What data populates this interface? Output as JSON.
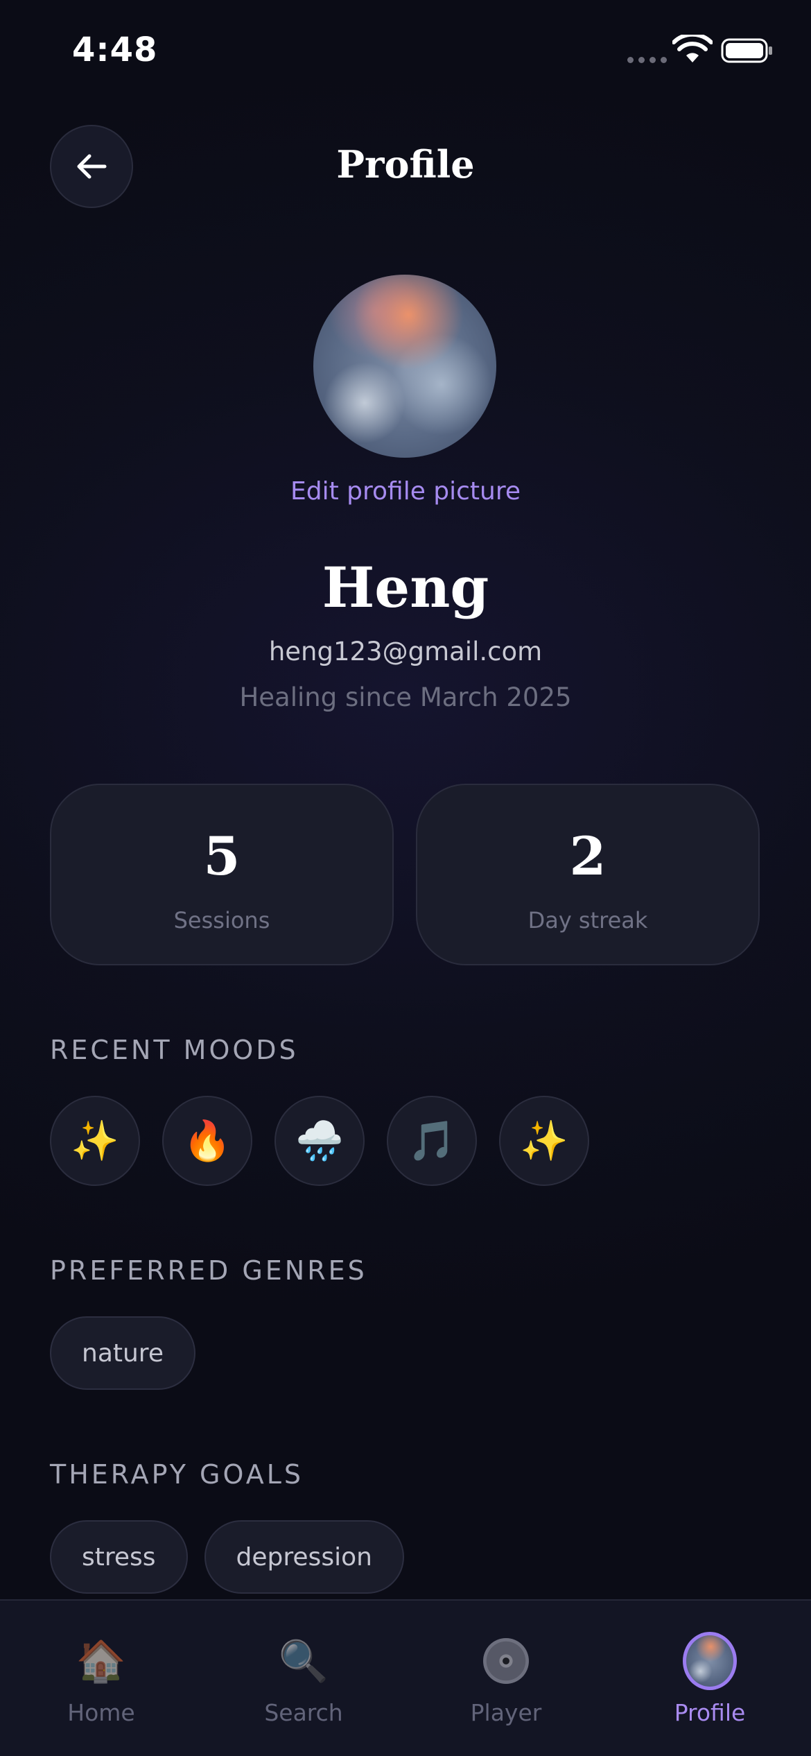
{
  "status_bar": {
    "time": "4:48"
  },
  "header": {
    "title": "Profile"
  },
  "profile": {
    "edit_picture_label": "Edit profile picture",
    "name": "Heng",
    "email": "heng123@gmail.com",
    "member_since": "Healing since March 2025"
  },
  "stats": [
    {
      "value": "5",
      "label": "Sessions"
    },
    {
      "value": "2",
      "label": "Day streak"
    }
  ],
  "recent_moods": {
    "heading": "RECENT MOODS",
    "items": [
      "✨",
      "🔥",
      "🌧️",
      "🎵",
      "✨"
    ]
  },
  "preferred_genres": {
    "heading": "PREFERRED GENRES",
    "items": [
      "nature"
    ]
  },
  "therapy_goals": {
    "heading": "THERAPY GOALS",
    "items": [
      "stress",
      "depression"
    ]
  },
  "tab_bar": {
    "tabs": [
      {
        "label": "Home",
        "icon": "🏠"
      },
      {
        "label": "Search",
        "icon": "🔍"
      },
      {
        "label": "Player",
        "icon": "disc"
      },
      {
        "label": "Profile",
        "icon": "avatar"
      }
    ],
    "active_tab": "Profile"
  },
  "colors": {
    "accent": "#a68bf0",
    "background": "#0e0f1d",
    "card": "#1a1c2a"
  }
}
